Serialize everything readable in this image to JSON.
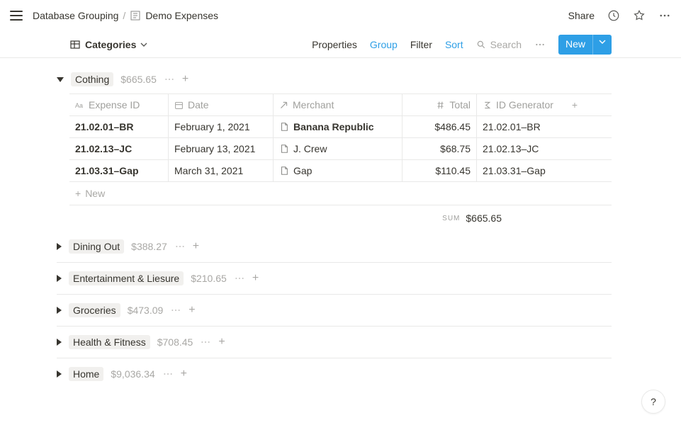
{
  "topbar": {
    "breadcrumb_parent": "Database Grouping",
    "breadcrumb_current": "Demo Expenses",
    "share_label": "Share"
  },
  "viewbar": {
    "view_label": "Categories",
    "properties": "Properties",
    "group": "Group",
    "filter": "Filter",
    "sort": "Sort",
    "search": "Search",
    "new": "New"
  },
  "columns": {
    "expense_id": "Expense ID",
    "date": "Date",
    "merchant": "Merchant",
    "total": "Total",
    "id_generator": "ID Generator"
  },
  "groups": {
    "open": {
      "name": "Cothing",
      "total": "$665.65",
      "rows": [
        {
          "id": "21.02.01–BR",
          "date": "February 1, 2021",
          "merchant": "Banana Republic",
          "total": "$486.45",
          "gen": "21.02.01–BR"
        },
        {
          "id": "21.02.13–JC",
          "date": "February 13, 2021",
          "merchant": "J. Crew",
          "total": "$68.75",
          "gen": "21.02.13–JC"
        },
        {
          "id": "21.03.31–Gap",
          "date": "March 31, 2021",
          "merchant": "Gap",
          "total": "$110.45",
          "gen": "21.03.31–Gap"
        }
      ],
      "new_label": "New",
      "sum_label": "Sum",
      "sum_value": "$665.65"
    },
    "collapsed": [
      {
        "name": "Dining Out",
        "total": "$388.27"
      },
      {
        "name": "Entertainment & Liesure",
        "total": "$210.65"
      },
      {
        "name": "Groceries",
        "total": "$473.09"
      },
      {
        "name": "Health & Fitness",
        "total": "$708.45"
      },
      {
        "name": "Home",
        "total": "$9,036.34"
      }
    ]
  },
  "help": "?"
}
